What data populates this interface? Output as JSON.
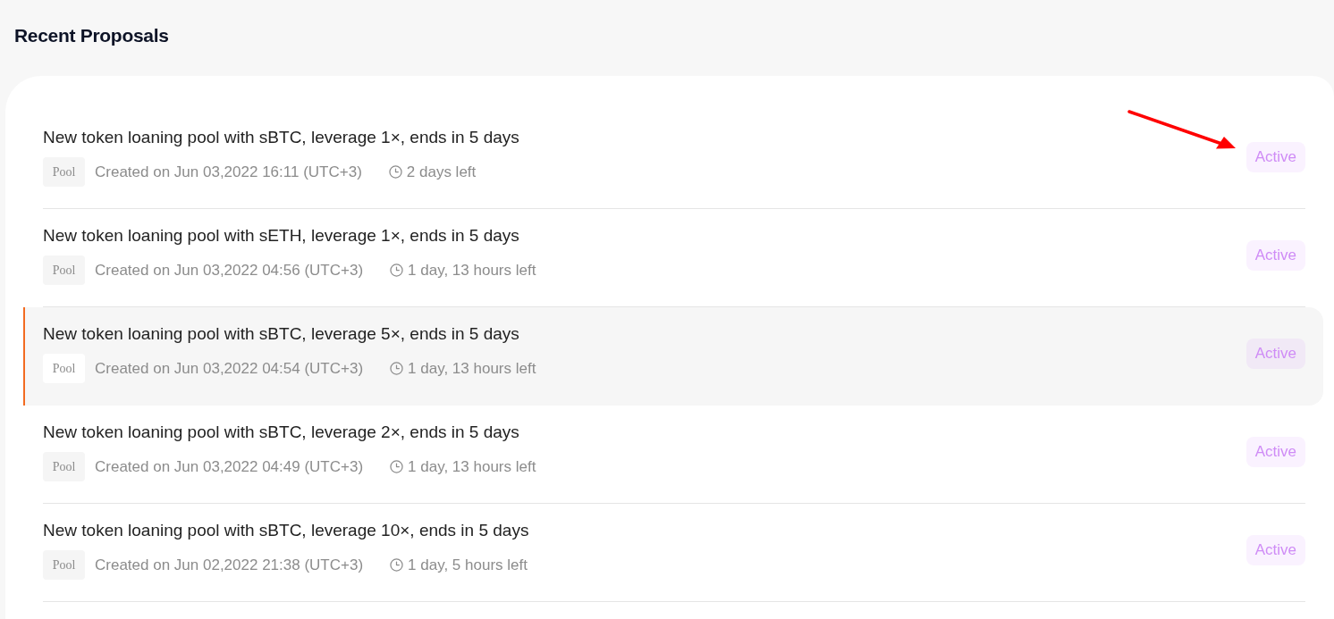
{
  "heading": "Recent Proposals",
  "proposals": [
    {
      "title": "New token loaning pool with sBTC, leverage 1×, ends in 5 days",
      "tag": "Pool",
      "created": "Created on Jun 03,2022 16:11 (UTC+3)",
      "time_left": "2 days left",
      "status": "Active",
      "highlighted": false
    },
    {
      "title": "New token loaning pool with sETH, leverage 1×, ends in 5 days",
      "tag": "Pool",
      "created": "Created on Jun 03,2022 04:56 (UTC+3)",
      "time_left": "1 day, 13 hours left",
      "status": "Active",
      "highlighted": false
    },
    {
      "title": "New token loaning pool with sBTC, leverage 5×, ends in 5 days",
      "tag": "Pool",
      "created": "Created on Jun 03,2022 04:54 (UTC+3)",
      "time_left": "1 day, 13 hours left",
      "status": "Active",
      "highlighted": true
    },
    {
      "title": "New token loaning pool with sBTC, leverage 2×, ends in 5 days",
      "tag": "Pool",
      "created": "Created on Jun 03,2022 04:49 (UTC+3)",
      "time_left": "1 day, 13 hours left",
      "status": "Active",
      "highlighted": false
    },
    {
      "title": "New token loaning pool with sBTC, leverage 10×, ends in 5 days",
      "tag": "Pool",
      "created": "Created on Jun 02,2022 21:38 (UTC+3)",
      "time_left": "1 day, 5 hours left",
      "status": "Active",
      "highlighted": false
    }
  ]
}
